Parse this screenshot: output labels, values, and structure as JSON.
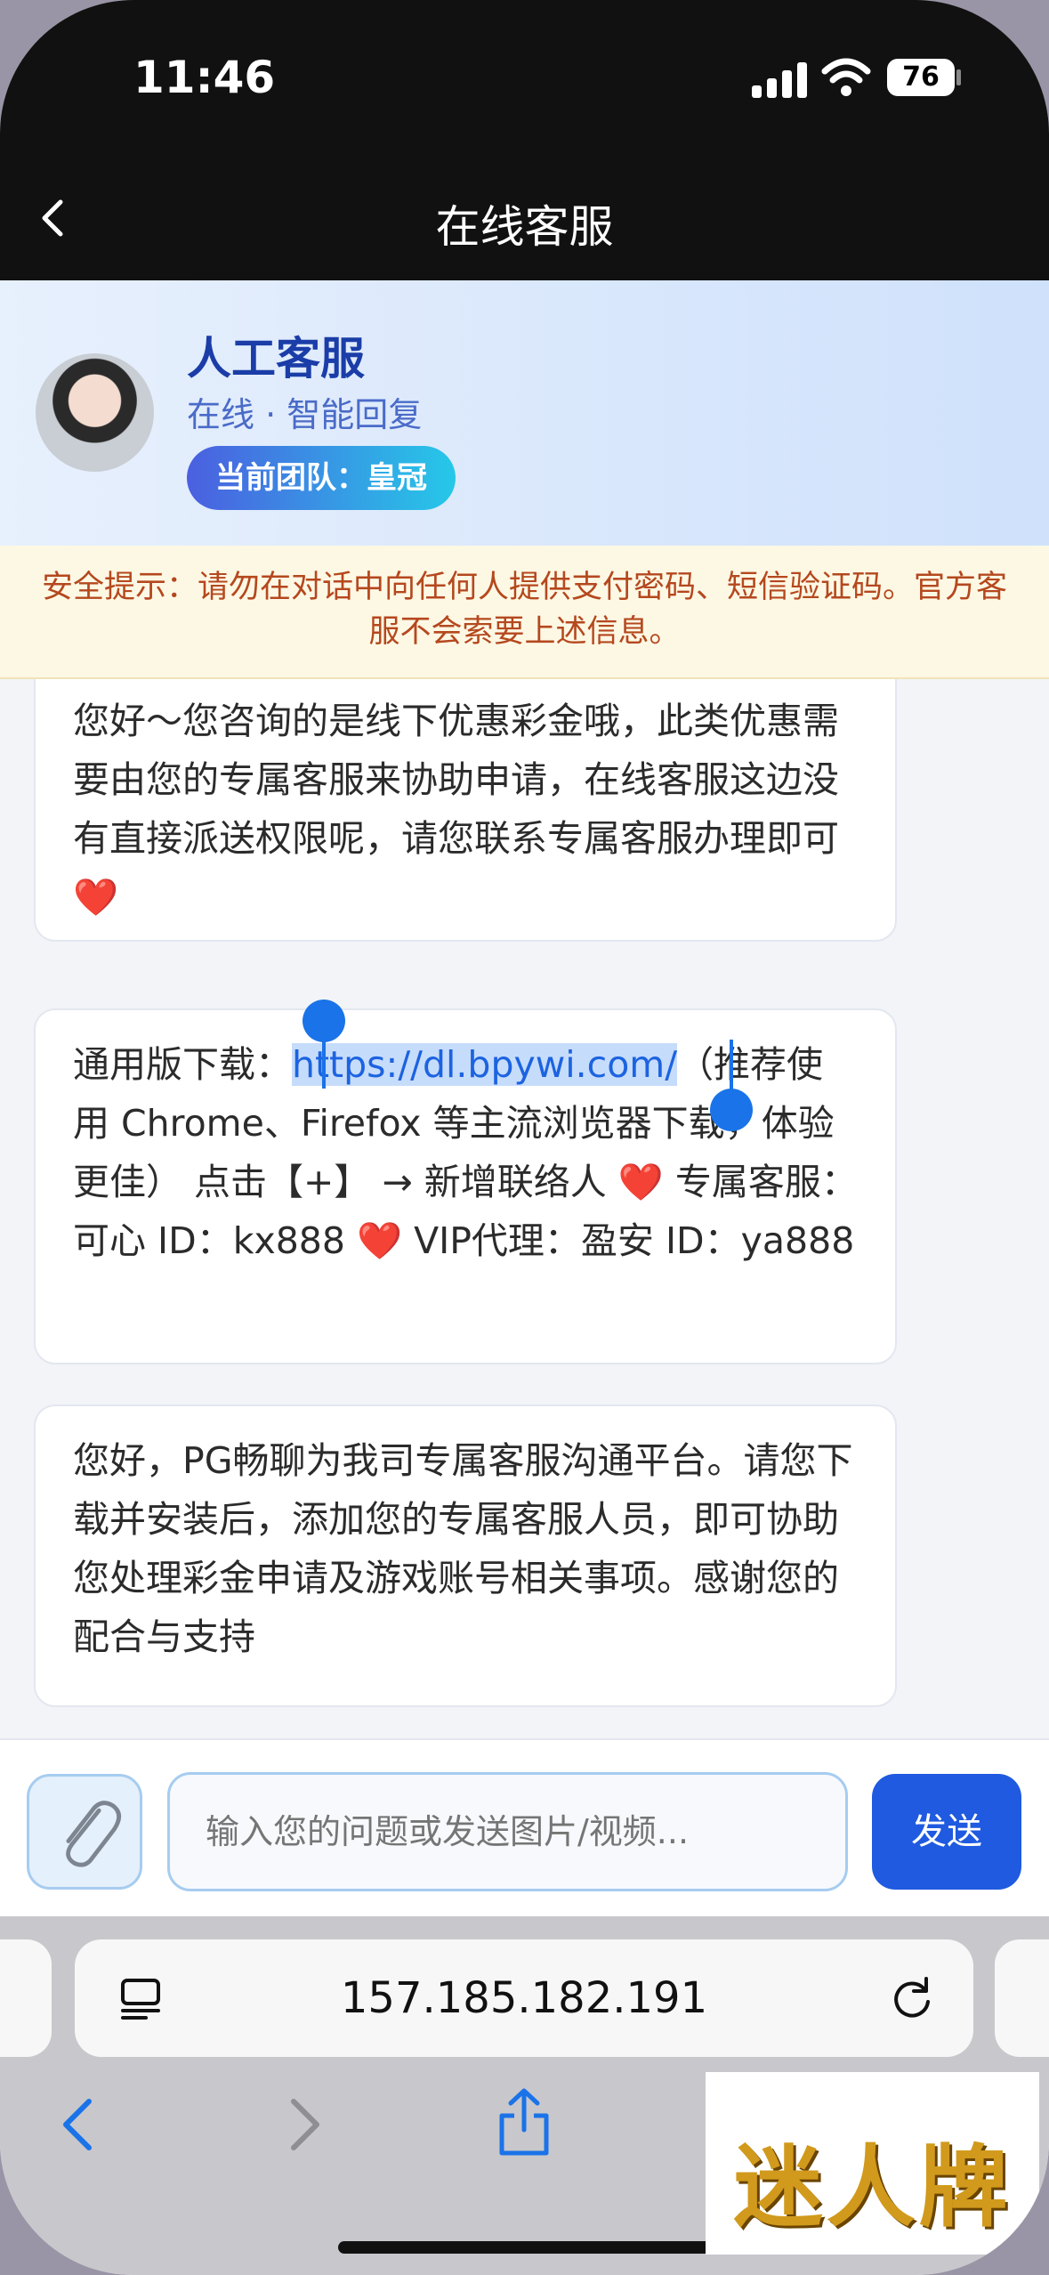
{
  "status_bar": {
    "time": "11:46",
    "battery": "76"
  },
  "nav": {
    "title": "在线客服"
  },
  "agent": {
    "name": "人工客服",
    "status": "在线 · 智能回复",
    "team_badge": "当前团队：皇冠"
  },
  "security_notice": "安全提示：请勿在对话中向任何人提供支付密码、短信验证码。官方客服不会索要上述信息。",
  "messages": [
    {
      "text": "您好～您咨询的是线下优惠彩金哦，此类优惠需要由您的专属客服来协助申请，在线客服这边没有直接派送权限呢，请您联系专属客服办理即可❤️"
    },
    {
      "prefix": "通用版下载：",
      "link": "https://dl.bpywi.com/",
      "suffix": "（推荐使用 Chrome、Firefox 等主流浏览器下载，体验更佳） 点击【+】 → 新增联络人 ❤️ 专属客服：可心 ID：kx888 ❤️ VIP代理：盈安 ID：ya888"
    },
    {
      "text": "您好，PG畅聊为我司专属客服沟通平台。请您下载并安装后，添加您的专属客服人员，即可协助您处理彩金申请及游戏账号相关事项。感谢您的配合与支持"
    }
  ],
  "composer": {
    "placeholder": "输入您的问题或发送图片/视频...",
    "send_label": "发送"
  },
  "browser": {
    "url": "157.185.182.191"
  },
  "watermark": "迷人牌",
  "icons": {
    "back": "chevron-left-icon",
    "attach": "paperclip-icon",
    "reader": "reader-mode-icon",
    "reload": "reload-icon",
    "share": "share-icon"
  },
  "colors": {
    "accent": "#1f5ae0",
    "notice_text": "#b5481e",
    "agent_name": "#1b3da8"
  }
}
